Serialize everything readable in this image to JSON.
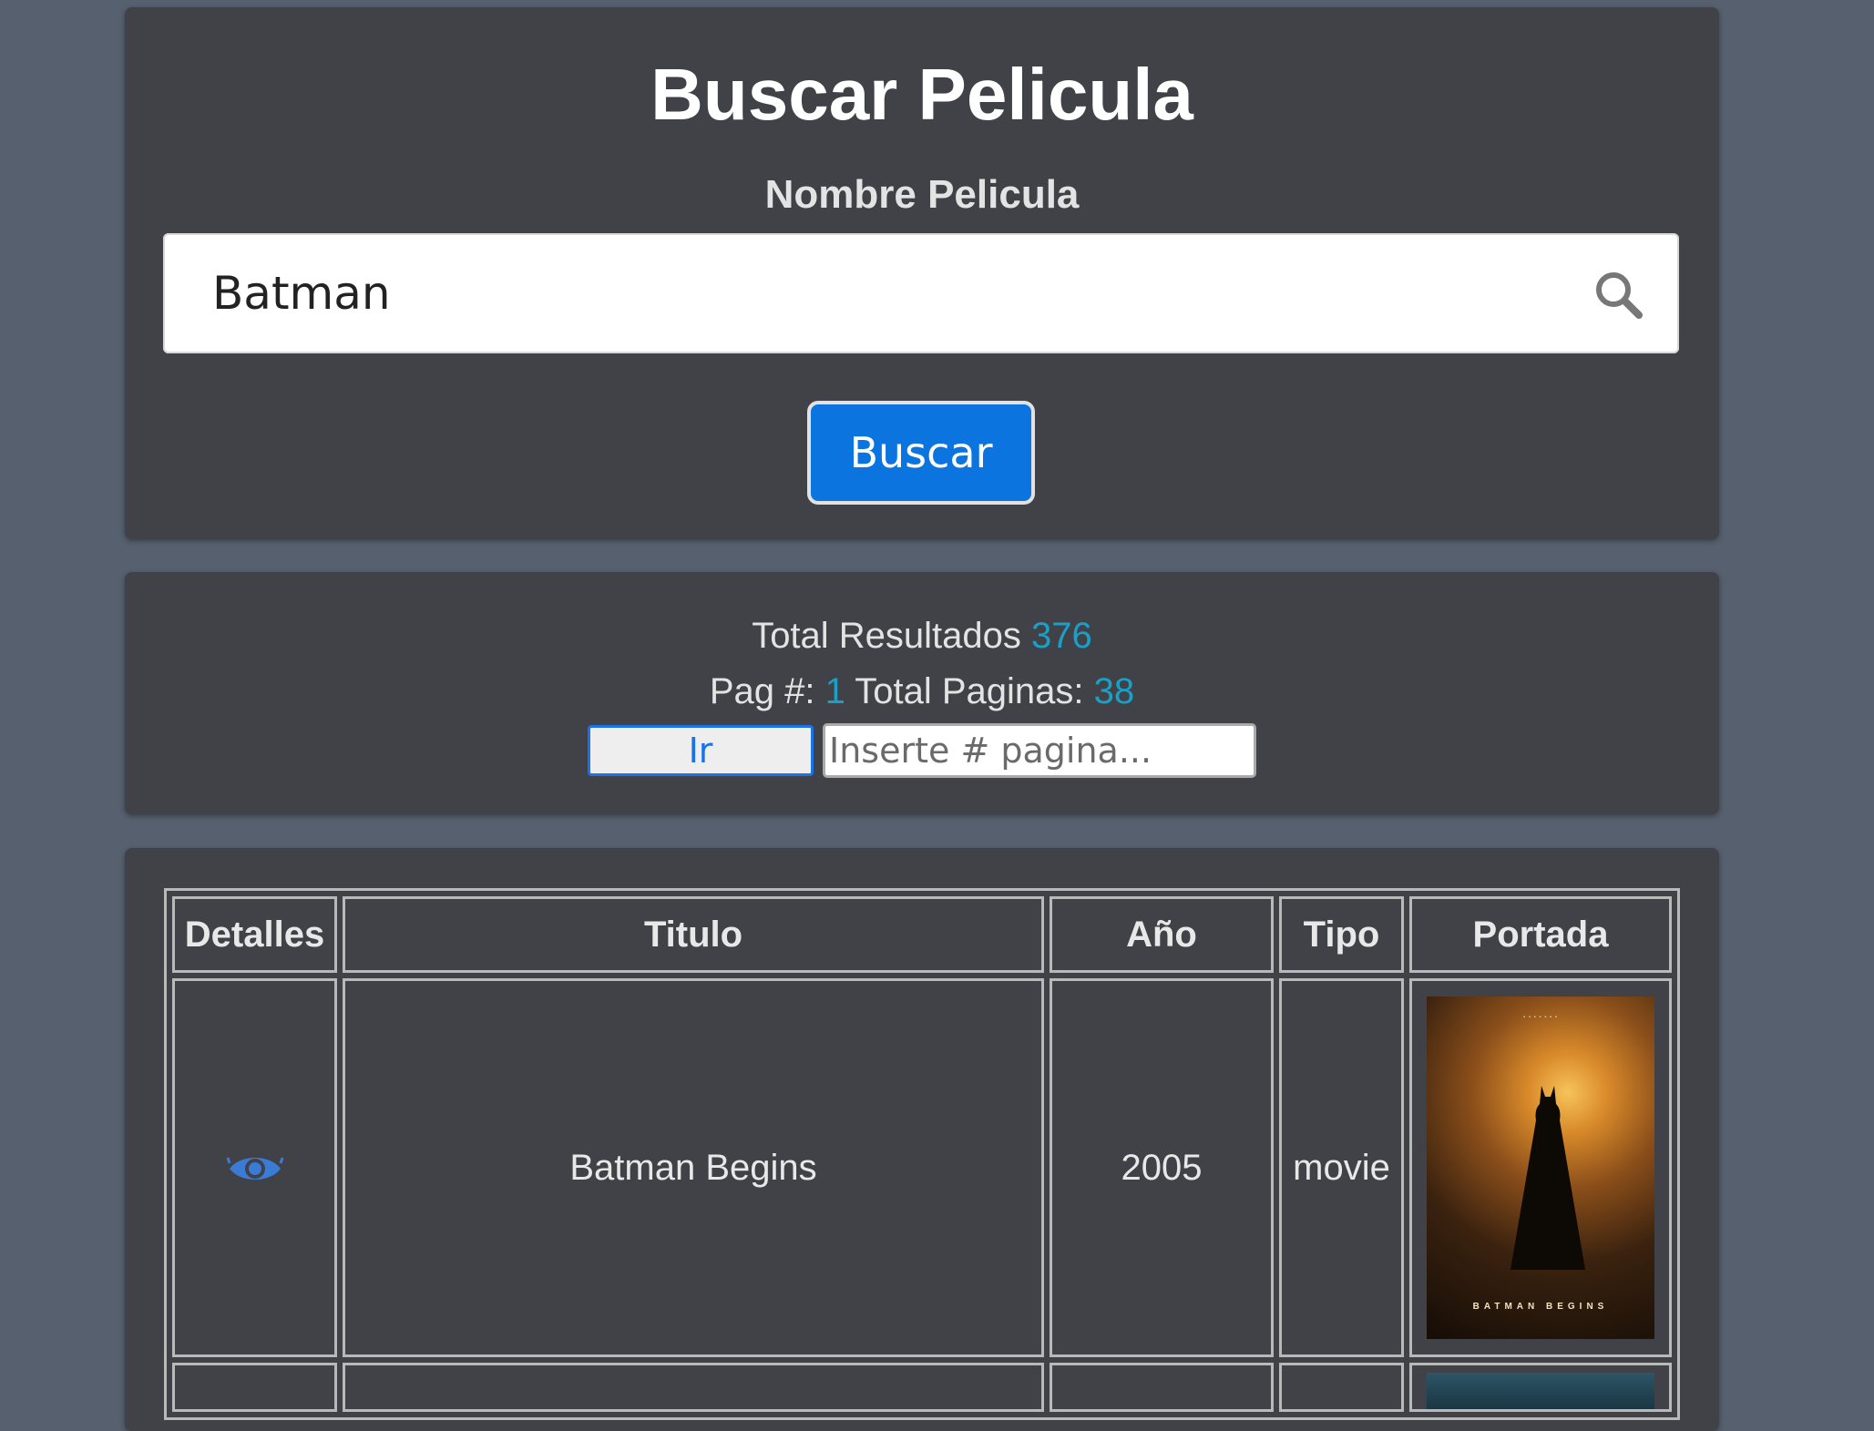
{
  "search": {
    "title": "Buscar Pelicula",
    "label": "Nombre Pelicula",
    "value": "Batman",
    "button": "Buscar"
  },
  "results": {
    "total_label": "Total Resultados",
    "total": "376",
    "page_label": "Pag #:",
    "page": "1",
    "pages_label": "Total Paginas:",
    "pages": "38",
    "go_button": "Ir",
    "page_placeholder": "Inserte # pagina..."
  },
  "table": {
    "headers": [
      "Detalles",
      "Titulo",
      "Año",
      "Tipo",
      "Portada"
    ],
    "rows": [
      {
        "title": "Batman Begins",
        "year": "2005",
        "type": "movie",
        "poster_title": "BATMAN BEGINS"
      }
    ]
  },
  "colors": {
    "background": "#56606e",
    "panel": "#414247",
    "accent": "#1aa0c8",
    "button": "#0b74de",
    "eye_icon": "#3a7bd5"
  }
}
